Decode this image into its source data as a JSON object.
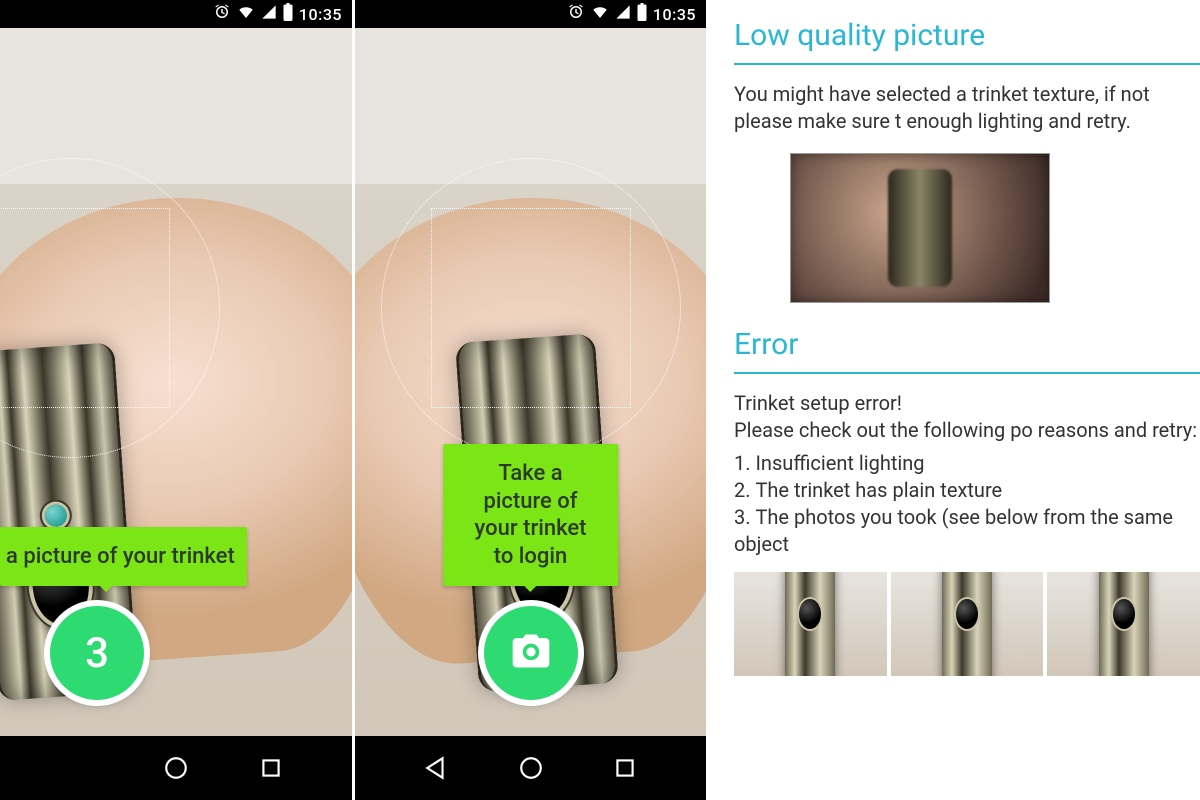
{
  "statusbar": {
    "time": "10:35"
  },
  "screen1": {
    "hint": "a picture of your trinket",
    "countdown": "3"
  },
  "screen2": {
    "hint": "Take a picture of your trinket to login"
  },
  "help": {
    "quality": {
      "heading": "Low quality picture",
      "body": "You might have selected a trinket texture, if not please make sure t enough  lighting and retry."
    },
    "error": {
      "heading": "Error",
      "intro1": "Trinket setup error!",
      "intro2": "Please check out the following po reasons and retry:",
      "reasons": [
        "Insufficient lighting",
        "The trinket has plain texture",
        "The photos you took (see below from the same object"
      ]
    }
  }
}
